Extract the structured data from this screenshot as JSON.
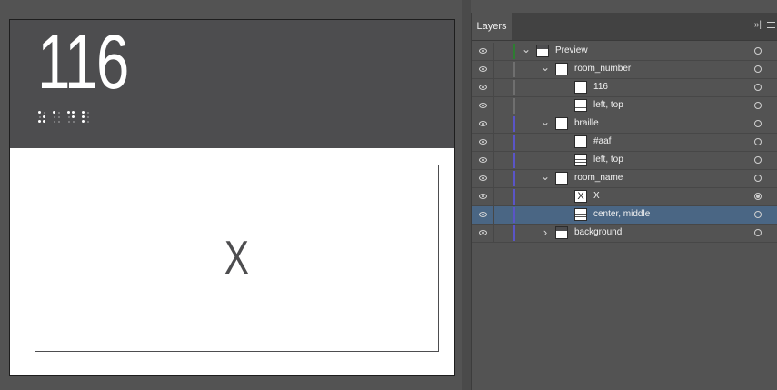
{
  "artboard": {
    "room_number": "116",
    "room_name": "X",
    "braille_cells": [
      [
        1,
        0,
        1,
        0,
        1,
        1
      ],
      [
        1,
        0,
        0,
        0,
        0,
        0
      ],
      [
        1,
        0,
        0,
        1,
        1,
        0
      ],
      [
        1,
        1,
        1,
        0,
        0,
        0
      ]
    ]
  },
  "panel": {
    "tab_label": "Layers",
    "collapse_label": "»|"
  },
  "layers": [
    {
      "id": "preview",
      "label": "Preview",
      "depth": 0,
      "expanded": true,
      "thumb": "header",
      "color": "#2e7d32",
      "selected": false,
      "target_filled": false
    },
    {
      "id": "room-number",
      "label": "room_number",
      "depth": 1,
      "expanded": true,
      "thumb": "plain",
      "color": "#6f6f6f",
      "selected": false,
      "target_filled": false
    },
    {
      "id": "room-number-text",
      "label": "116",
      "depth": 2,
      "expanded": null,
      "thumb": "plain",
      "color": "#6f6f6f",
      "selected": false,
      "target_filled": false
    },
    {
      "id": "room-number-align",
      "label": "left, top",
      "depth": 2,
      "expanded": null,
      "thumb": "striped",
      "color": "#6f6f6f",
      "selected": false,
      "target_filled": false
    },
    {
      "id": "braille",
      "label": "braille",
      "depth": 1,
      "expanded": true,
      "thumb": "plain",
      "color": "#5a55c7",
      "selected": false,
      "target_filled": false
    },
    {
      "id": "braille-text",
      "label": "#aaf",
      "depth": 2,
      "expanded": null,
      "thumb": "plain",
      "color": "#5a55c7",
      "selected": false,
      "target_filled": false
    },
    {
      "id": "braille-align",
      "label": "left, top",
      "depth": 2,
      "expanded": null,
      "thumb": "striped",
      "color": "#5a55c7",
      "selected": false,
      "target_filled": false
    },
    {
      "id": "room-name",
      "label": "room_name",
      "depth": 1,
      "expanded": true,
      "thumb": "plain",
      "color": "#5a55c7",
      "selected": false,
      "target_filled": false
    },
    {
      "id": "room-name-text",
      "label": "X",
      "depth": 2,
      "expanded": null,
      "thumb": "glyph",
      "glyph": "X",
      "color": "#5a55c7",
      "selected": false,
      "target_filled": true
    },
    {
      "id": "room-name-align",
      "label": "center, middle",
      "depth": 2,
      "expanded": null,
      "thumb": "striped",
      "color": "#5a55c7",
      "selected": true,
      "target_filled": false
    },
    {
      "id": "background",
      "label": "background",
      "depth": 1,
      "expanded": false,
      "thumb": "header",
      "color": "#5a55c7",
      "selected": false,
      "target_filled": false
    }
  ]
}
